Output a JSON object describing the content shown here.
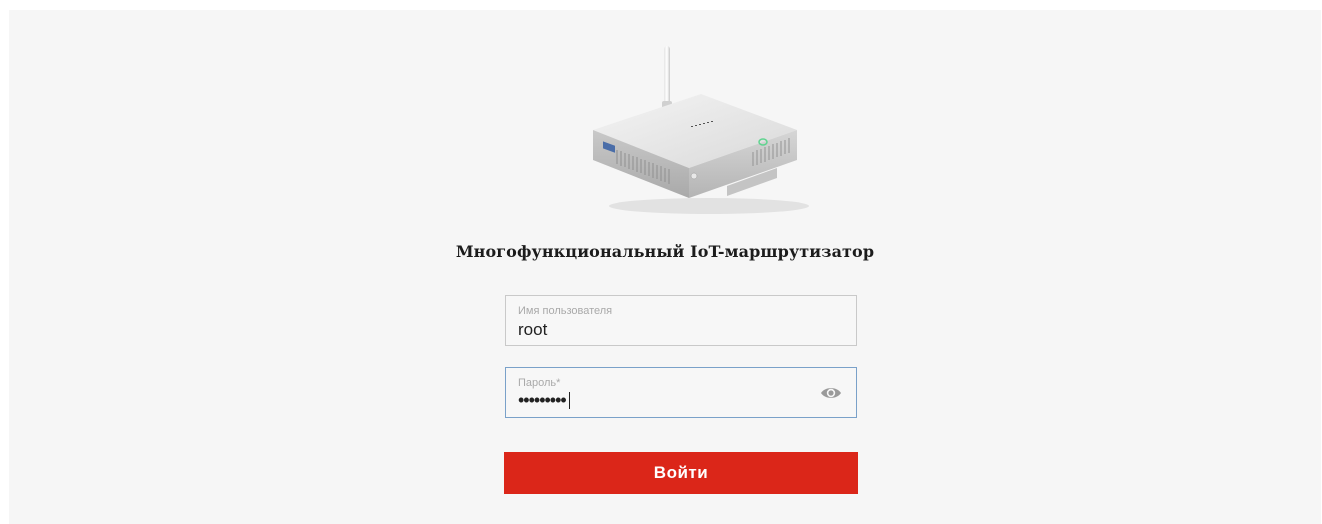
{
  "page": {
    "title": "Многофункциональный IoT-маршрутизатор"
  },
  "router_image": {
    "icon": "router-image",
    "led_color": "#5fd48f"
  },
  "login": {
    "username": {
      "label": "Имя пользователя",
      "value": "root"
    },
    "password": {
      "label": "Пароль*",
      "value": "•••••••••",
      "toggle_icon": "eye-icon"
    },
    "submit_label": "Войти",
    "accent_color": "#db2619"
  }
}
